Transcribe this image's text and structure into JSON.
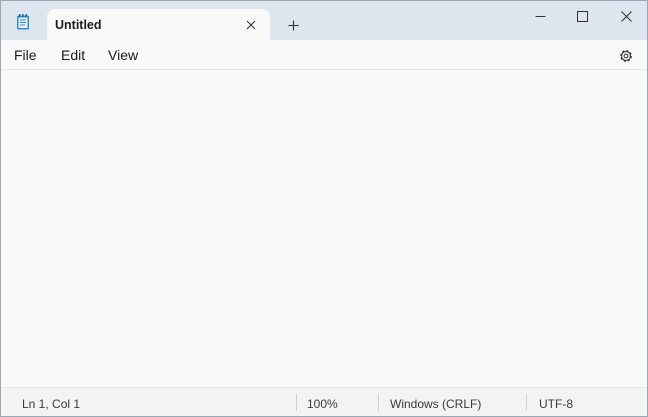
{
  "tab": {
    "title": "Untitled",
    "icon": "notepad-icon"
  },
  "new_tab": {
    "icon": "plus-icon"
  },
  "window_controls": {
    "minimize": "minimize-icon",
    "maximize": "maximize-icon",
    "close": "close-icon"
  },
  "menu": {
    "file": "File",
    "edit": "Edit",
    "view": "View",
    "settings_icon": "gear-icon"
  },
  "editor": {
    "content": ""
  },
  "status": {
    "position": "Ln 1, Col 1",
    "zoom": "100%",
    "line_ending": "Windows (CRLF)",
    "encoding": "UTF-8"
  },
  "colors": {
    "titlebar": "#dde6ef",
    "surface": "#f9f9f9",
    "statusbar": "#f3f3f3"
  }
}
